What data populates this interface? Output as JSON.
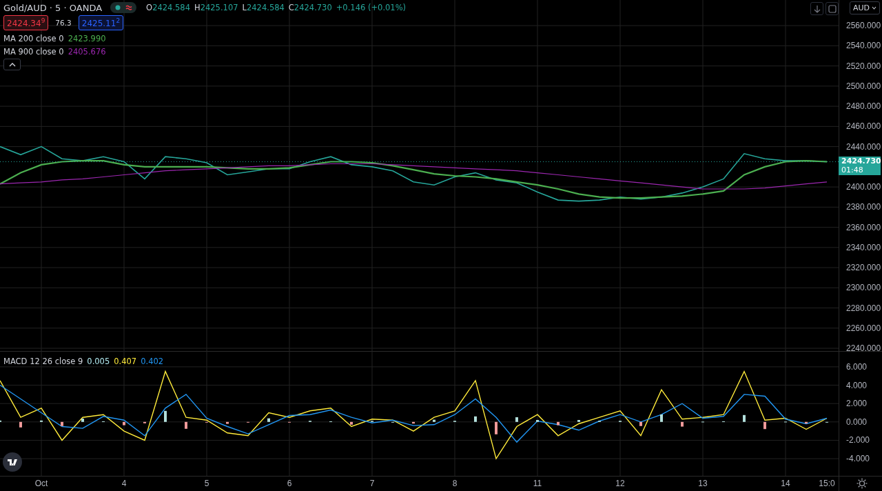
{
  "header": {
    "symbol": "Gold/AUD · 5 · OANDA",
    "status_icons": [
      {
        "kind": "dot",
        "color": "#26a69a"
      },
      {
        "kind": "wave",
        "color": "#f23645"
      }
    ],
    "ohlc": [
      {
        "label": "O",
        "value": "2424.584"
      },
      {
        "label": "H",
        "value": "2425.107"
      },
      {
        "label": "L",
        "value": "2424.584"
      },
      {
        "label": "C",
        "value": "2424.730"
      }
    ],
    "change": "+0.146 (+0.01%)"
  },
  "quote": {
    "sell": "2424.34$^{9}$",
    "spread": "76.3",
    "buy": "2425.11$^{2}$"
  },
  "indicators": [
    {
      "label": "MA 200 close 0",
      "value": "2423.990",
      "color": "#4caf50"
    },
    {
      "label": "MA 900 close 0",
      "value": "2405.676",
      "color": "#9c27b0"
    }
  ],
  "currency_button": "AUD",
  "price_label": {
    "price": "2424.730",
    "countdown": "01:48"
  },
  "main_chart": {
    "chart_data": {
      "type": "line",
      "grid": true,
      "ylim": [
        2237.3,
        2585.4
      ],
      "yticks": [
        {
          "value": 2240,
          "label": "2240.000"
        },
        {
          "value": 2260,
          "label": "2260.000"
        },
        {
          "value": 2280,
          "label": "2280.000"
        },
        {
          "value": 2300,
          "label": "2300.000"
        },
        {
          "value": 2320,
          "label": "2320.000"
        },
        {
          "value": 2340,
          "label": "2340.000"
        },
        {
          "value": 2360,
          "label": "2360.000"
        },
        {
          "value": 2380,
          "label": "2380.000"
        },
        {
          "value": 2400,
          "label": "2400.000"
        },
        {
          "value": 2440,
          "label": "2440.000"
        },
        {
          "value": 2460,
          "label": "2460.000"
        },
        {
          "value": 2480,
          "label": "2480.000"
        },
        {
          "value": 2500,
          "label": "2500.000"
        },
        {
          "value": 2520,
          "label": "2520.000"
        },
        {
          "value": 2540,
          "label": "2540.000"
        },
        {
          "value": 2560,
          "label": "2560.000"
        }
      ],
      "series": [
        {
          "color": "#26a69a",
          "values": [
            2440,
            2432,
            2440,
            2428,
            2426,
            2430,
            2425,
            2408,
            2430,
            2428,
            2424,
            2412,
            2415,
            2418,
            2418,
            2425,
            2430,
            2422,
            2420,
            2416,
            2405,
            2402,
            2410,
            2414,
            2407,
            2404,
            2395,
            2387,
            2386,
            2387,
            2390,
            2388,
            2390,
            2394,
            2400,
            2408,
            2433,
            2428,
            2426,
            2426,
            2425
          ]
        },
        {
          "color": "#4caf50",
          "values": [
            2403,
            2414,
            2422,
            2425,
            2426,
            2426,
            2422,
            2420,
            2420,
            2420,
            2420,
            2419,
            2418,
            2418,
            2419,
            2422,
            2425,
            2425,
            2424,
            2421,
            2417,
            2413,
            2411,
            2410,
            2408,
            2405,
            2402,
            2398,
            2393,
            2390,
            2389,
            2389,
            2390,
            2391,
            2393,
            2396,
            2412,
            2420,
            2425,
            2426,
            2425
          ]
        },
        {
          "color": "#9c27b0",
          "values": [
            2403,
            2404,
            2405,
            2407,
            2408,
            2410,
            2412,
            2414,
            2416,
            2417,
            2418,
            2419,
            2420,
            2421,
            2421,
            2422,
            2423,
            2423,
            2423,
            2422,
            2421,
            2420,
            2419,
            2418,
            2417,
            2416,
            2414,
            2412,
            2410,
            2408,
            2406,
            2404,
            2402,
            2400,
            2398,
            2398,
            2398,
            2399,
            2401,
            2403,
            2405
          ]
        }
      ]
    }
  },
  "macd": {
    "label": "MACD 12 26 close 9",
    "values": [
      {
        "text": "0.005",
        "color": "#b2ebf2"
      },
      {
        "text": "0.407",
        "color": "#ffeb3b"
      },
      {
        "text": "0.402",
        "color": "#2196f3"
      }
    ],
    "chart_data": {
      "type": "line",
      "grid": true,
      "ylim": [
        -5.87,
        7.72
      ],
      "yticks": [
        {
          "value": -4,
          "label": "-4.000"
        },
        {
          "value": -2,
          "label": "-2.000"
        },
        {
          "value": 0,
          "label": "0.000"
        },
        {
          "value": 2,
          "label": "2.000"
        },
        {
          "value": 4,
          "label": "4.000"
        },
        {
          "value": 6,
          "label": "6.000"
        }
      ],
      "categories": [
        null,
        null,
        "Oct",
        null,
        null,
        null,
        "4",
        null,
        null,
        null,
        "5",
        null,
        null,
        null,
        "6",
        null,
        null,
        null,
        "7",
        null,
        null,
        null,
        "8",
        null,
        null,
        null,
        "11",
        null,
        null,
        null,
        "12",
        null,
        null,
        null,
        "13",
        null,
        null,
        null,
        "14",
        null,
        "15:0"
      ],
      "series": [
        {
          "color": "#ffeb3b",
          "values": [
            4.5,
            0.5,
            1.5,
            -2,
            0.5,
            0.8,
            -1,
            -2,
            5.5,
            0.5,
            0.2,
            -1.2,
            -1.5,
            1,
            0.5,
            1.2,
            1.5,
            -0.5,
            0.3,
            0.2,
            -1,
            0.5,
            1.2,
            4.5,
            -4,
            -0.5,
            0.8,
            -1.5,
            -0.2,
            0.5,
            1.2,
            -1.5,
            3.5,
            0.3,
            0.5,
            0.8,
            5.5,
            0.2,
            0.4,
            -0.8,
            0.4
          ]
        },
        {
          "color": "#2196f3",
          "values": [
            4,
            2.5,
            1,
            -0.5,
            -0.7,
            0.6,
            0.2,
            -1.5,
            1.5,
            3,
            0.4,
            -0.5,
            -1.3,
            -0.3,
            0.7,
            0.8,
            1.3,
            0.5,
            -0.1,
            0.2,
            -0.4,
            -0.3,
            0.8,
            2.5,
            0.5,
            -2.2,
            0.1,
            -0.3,
            -0.9,
            0.1,
            0.8,
            0,
            0.8,
            2,
            0.4,
            0.6,
            3,
            2.8,
            0.3,
            -0.2,
            0.4
          ]
        }
      ]
    }
  }
}
